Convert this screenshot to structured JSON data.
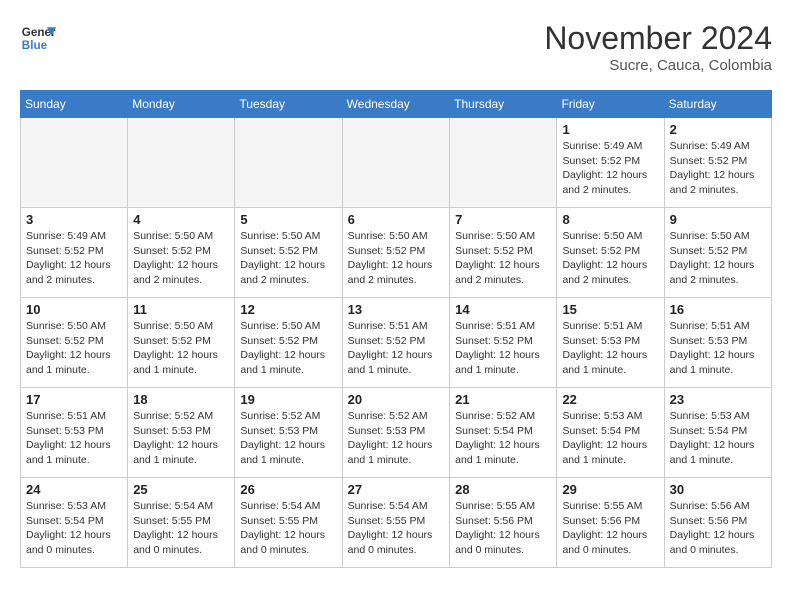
{
  "header": {
    "logo_line1": "General",
    "logo_line2": "Blue",
    "month": "November 2024",
    "location": "Sucre, Cauca, Colombia"
  },
  "weekdays": [
    "Sunday",
    "Monday",
    "Tuesday",
    "Wednesday",
    "Thursday",
    "Friday",
    "Saturday"
  ],
  "weeks": [
    [
      {
        "day": "",
        "info": ""
      },
      {
        "day": "",
        "info": ""
      },
      {
        "day": "",
        "info": ""
      },
      {
        "day": "",
        "info": ""
      },
      {
        "day": "",
        "info": ""
      },
      {
        "day": "1",
        "info": "Sunrise: 5:49 AM\nSunset: 5:52 PM\nDaylight: 12 hours\nand 2 minutes."
      },
      {
        "day": "2",
        "info": "Sunrise: 5:49 AM\nSunset: 5:52 PM\nDaylight: 12 hours\nand 2 minutes."
      }
    ],
    [
      {
        "day": "3",
        "info": "Sunrise: 5:49 AM\nSunset: 5:52 PM\nDaylight: 12 hours\nand 2 minutes."
      },
      {
        "day": "4",
        "info": "Sunrise: 5:50 AM\nSunset: 5:52 PM\nDaylight: 12 hours\nand 2 minutes."
      },
      {
        "day": "5",
        "info": "Sunrise: 5:50 AM\nSunset: 5:52 PM\nDaylight: 12 hours\nand 2 minutes."
      },
      {
        "day": "6",
        "info": "Sunrise: 5:50 AM\nSunset: 5:52 PM\nDaylight: 12 hours\nand 2 minutes."
      },
      {
        "day": "7",
        "info": "Sunrise: 5:50 AM\nSunset: 5:52 PM\nDaylight: 12 hours\nand 2 minutes."
      },
      {
        "day": "8",
        "info": "Sunrise: 5:50 AM\nSunset: 5:52 PM\nDaylight: 12 hours\nand 2 minutes."
      },
      {
        "day": "9",
        "info": "Sunrise: 5:50 AM\nSunset: 5:52 PM\nDaylight: 12 hours\nand 2 minutes."
      }
    ],
    [
      {
        "day": "10",
        "info": "Sunrise: 5:50 AM\nSunset: 5:52 PM\nDaylight: 12 hours\nand 1 minute."
      },
      {
        "day": "11",
        "info": "Sunrise: 5:50 AM\nSunset: 5:52 PM\nDaylight: 12 hours\nand 1 minute."
      },
      {
        "day": "12",
        "info": "Sunrise: 5:50 AM\nSunset: 5:52 PM\nDaylight: 12 hours\nand 1 minute."
      },
      {
        "day": "13",
        "info": "Sunrise: 5:51 AM\nSunset: 5:52 PM\nDaylight: 12 hours\nand 1 minute."
      },
      {
        "day": "14",
        "info": "Sunrise: 5:51 AM\nSunset: 5:52 PM\nDaylight: 12 hours\nand 1 minute."
      },
      {
        "day": "15",
        "info": "Sunrise: 5:51 AM\nSunset: 5:53 PM\nDaylight: 12 hours\nand 1 minute."
      },
      {
        "day": "16",
        "info": "Sunrise: 5:51 AM\nSunset: 5:53 PM\nDaylight: 12 hours\nand 1 minute."
      }
    ],
    [
      {
        "day": "17",
        "info": "Sunrise: 5:51 AM\nSunset: 5:53 PM\nDaylight: 12 hours\nand 1 minute."
      },
      {
        "day": "18",
        "info": "Sunrise: 5:52 AM\nSunset: 5:53 PM\nDaylight: 12 hours\nand 1 minute."
      },
      {
        "day": "19",
        "info": "Sunrise: 5:52 AM\nSunset: 5:53 PM\nDaylight: 12 hours\nand 1 minute."
      },
      {
        "day": "20",
        "info": "Sunrise: 5:52 AM\nSunset: 5:53 PM\nDaylight: 12 hours\nand 1 minute."
      },
      {
        "day": "21",
        "info": "Sunrise: 5:52 AM\nSunset: 5:54 PM\nDaylight: 12 hours\nand 1 minute."
      },
      {
        "day": "22",
        "info": "Sunrise: 5:53 AM\nSunset: 5:54 PM\nDaylight: 12 hours\nand 1 minute."
      },
      {
        "day": "23",
        "info": "Sunrise: 5:53 AM\nSunset: 5:54 PM\nDaylight: 12 hours\nand 1 minute."
      }
    ],
    [
      {
        "day": "24",
        "info": "Sunrise: 5:53 AM\nSunset: 5:54 PM\nDaylight: 12 hours\nand 0 minutes."
      },
      {
        "day": "25",
        "info": "Sunrise: 5:54 AM\nSunset: 5:55 PM\nDaylight: 12 hours\nand 0 minutes."
      },
      {
        "day": "26",
        "info": "Sunrise: 5:54 AM\nSunset: 5:55 PM\nDaylight: 12 hours\nand 0 minutes."
      },
      {
        "day": "27",
        "info": "Sunrise: 5:54 AM\nSunset: 5:55 PM\nDaylight: 12 hours\nand 0 minutes."
      },
      {
        "day": "28",
        "info": "Sunrise: 5:55 AM\nSunset: 5:56 PM\nDaylight: 12 hours\nand 0 minutes."
      },
      {
        "day": "29",
        "info": "Sunrise: 5:55 AM\nSunset: 5:56 PM\nDaylight: 12 hours\nand 0 minutes."
      },
      {
        "day": "30",
        "info": "Sunrise: 5:56 AM\nSunset: 5:56 PM\nDaylight: 12 hours\nand 0 minutes."
      }
    ]
  ]
}
